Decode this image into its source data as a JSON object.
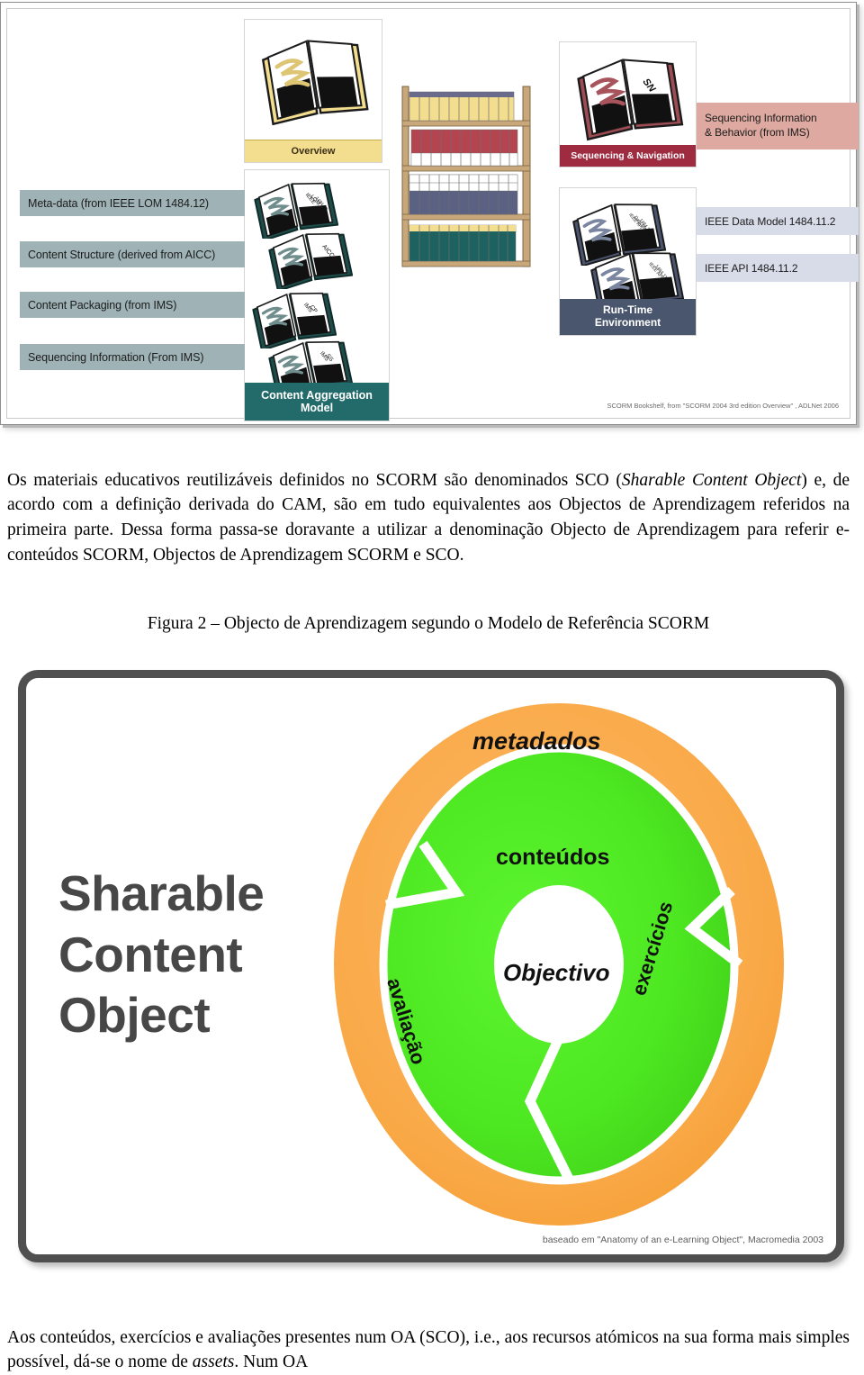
{
  "figure1": {
    "name": "SCORM Bookshelf diagram",
    "panels": {
      "overview": {
        "label": "Overview",
        "book_label": "",
        "color": "#f3dd8e"
      },
      "content_aggregation_model": {
        "label_line1": "Content Aggregation",
        "label_line2": "Model",
        "color": "#236b6b",
        "books": [
          "IEEE LOM 1484.12",
          "AICC",
          "IMS CP",
          "IMS SS"
        ]
      },
      "sequencing_navigation": {
        "label": "Sequencing & Navigation",
        "book_label": "SN",
        "color": "#9e2b3f"
      },
      "run_time_environment": {
        "label_line1": "Run-Time",
        "label_line2": "Environment",
        "color": "#4a566e",
        "books": [
          "IEEE API Data Model 1484.11.2",
          "IEEE API 1484.11.2"
        ]
      }
    },
    "left_chips": [
      {
        "label": "Meta-data (from IEEE LOM 1484.12)"
      },
      {
        "label": "Content Structure (derived from AICC)"
      },
      {
        "label": "Content Packaging (from IMS)"
      },
      {
        "label": "Sequencing Information (From IMS)"
      }
    ],
    "right_chips": [
      {
        "label": "Sequencing Information & Behavior (from IMS)",
        "line1": "Sequencing Information",
        "line2": "& Behavior (from IMS)"
      },
      {
        "label": "IEEE Data Model 1484.11.2"
      },
      {
        "label": "IEEE API 1484.11.2"
      }
    ],
    "credit": "SCORM Bookshelf, from \"SCORM 2004 3rd edition Overview\" , ADLNet  2006",
    "colors": {
      "chip_left": "#9fb3b6",
      "chip_sn": "#dda9a0",
      "chip_rte": "#d8dbe8",
      "overview": "#f3dd8e",
      "cam": "#236b6b",
      "sn": "#9e2b3f",
      "rte": "#4a566e"
    }
  },
  "paragraph1": {
    "part1": "Os materiais educativos reutilizáveis definidos no SCORM são denominados SCO (",
    "italic": "Sharable Content Object",
    "part2": ") e, de acordo com a definição derivada do CAM, são em tudo equivalentes aos Objectos de Aprendizagem referidos na primeira parte. Dessa forma passa-se doravante a utilizar a denominação Objecto de Aprendizagem para referir e-conteúdos SCORM, Objectos de Aprendizagem SCORM e SCO."
  },
  "caption2": "Figura 2 – Objecto de Aprendizagem segundo o Modelo de Referência SCORM",
  "figure2": {
    "name": "Sharable Content Object anatomy donut",
    "title_line1": "Sharable",
    "title_line2": "Content",
    "title_line3": "Object",
    "labels": {
      "outer_ring": "metadados",
      "inner_ring": "conteúdos",
      "core": "Objectivo",
      "segment_left": "avaliação",
      "segment_right": "exercícios"
    },
    "credit": "baseado em \"Anatomy of an e-Learning Object\", Macromedia 2003",
    "colors": {
      "outer_ring": "#f9a846",
      "inner_ring": "#4ee822",
      "core": "#ffffff",
      "frame": "#4f4f4f"
    }
  },
  "paragraph2": {
    "part1": "Aos conteúdos, exercícios e avaliações presentes num OA (SCO), i.e., aos recursos atómicos na sua forma mais simples possível, dá-se o nome de ",
    "italic": "assets",
    "part2": ". Num OA"
  }
}
